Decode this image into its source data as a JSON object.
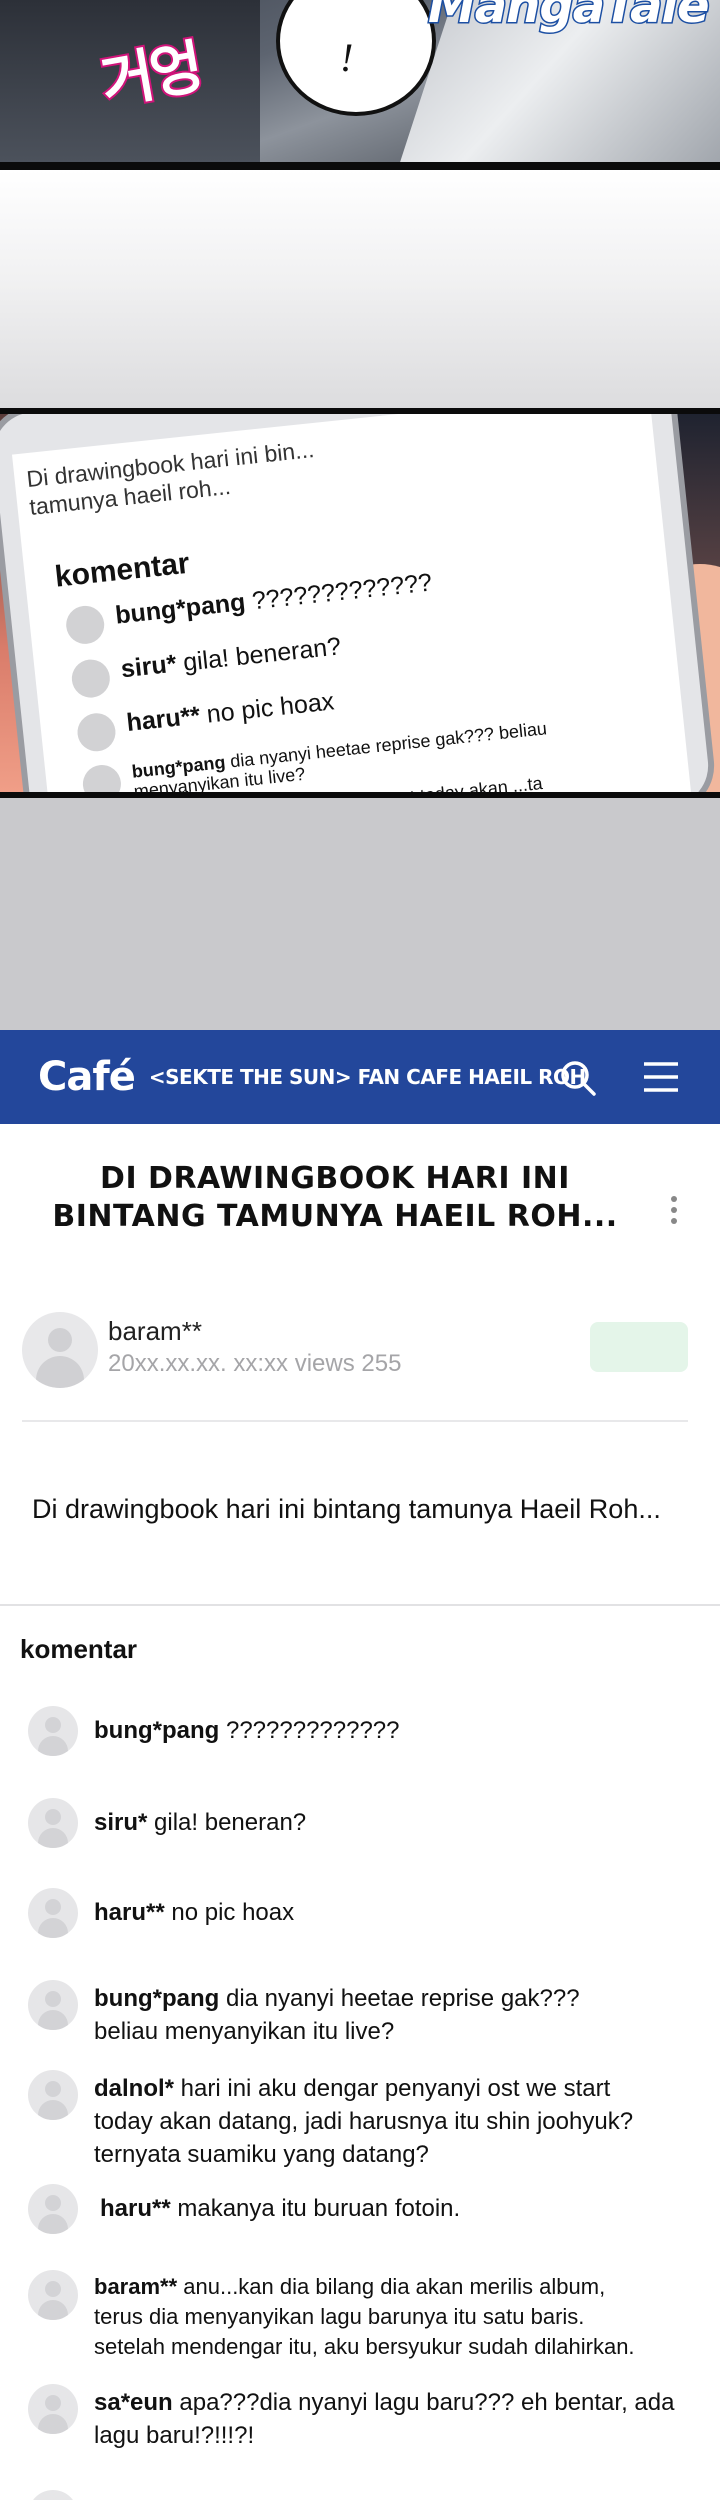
{
  "panel_top": {
    "sfx": "거엉",
    "bubble_text": "!",
    "watermark": "MangaTale"
  },
  "phone_screen": {
    "post_preview": "Di drawingbook hari ini bin... tamunya haeil roh...",
    "komentar_label": "komentar",
    "comments": [
      {
        "user": "bung*pang",
        "text": " ?????????????"
      },
      {
        "user": "siru*",
        "text": " gila! beneran?"
      },
      {
        "user": "haru**",
        "text": " no pic hoax"
      },
      {
        "user": "bung*pang",
        "text": " dia nyanyi heetae reprise gak??? beliau menyanyikan itu live?"
      },
      {
        "user": "",
        "text": "...aku dengar penyanyi ost we start today akan ...ta suamiku yang datang?"
      }
    ]
  },
  "cafe": {
    "logo": "Café",
    "title": "<SEKTE THE SUN> FAN CAFE HAEIL ROH",
    "post_title_line1": "DI DRAWINGBOOK HARI INI",
    "post_title_line2": "BINTANG TAMUNYA HAEIL ROH...",
    "author_name": "baram**",
    "author_meta": "20xx.xx.xx. xx:xx views 255",
    "post_body": "Di drawingbook hari ini bintang tamunya Haeil Roh...",
    "comments_heading": "komentar",
    "comments": [
      {
        "user": "bung*pang",
        "text": " ?????????????"
      },
      {
        "user": "siru*",
        "text": " gila! beneran?"
      },
      {
        "user": "haru**",
        "text": " no pic hoax"
      },
      {
        "user": "bung*pang",
        "text": " dia nyanyi heetae reprise gak???",
        "text2": "beliau menyanyikan itu live?"
      },
      {
        "user": "dalnol*",
        "text": " hari ini aku dengar penyanyi ost we start",
        "text2": "today akan datang, jadi harusnya itu shin joohyuk?",
        "text3": "ternyata suamiku yang datang?"
      },
      {
        "user": "haru**",
        "text": " makanya itu buruan fotoin."
      },
      {
        "user": "baram**",
        "text": " anu...kan dia bilang dia akan merilis album,",
        "text2": "terus dia menyanyikan lagu barunya itu satu baris.",
        "text3": "setelah mendengar itu, aku bersyukur sudah dilahirkan."
      },
      {
        "user": "sa*eun",
        "text": " apa???dia nyanyi lagu baru??? eh bentar, ada",
        "text2": "lagu baru!?!!!?!"
      }
    ],
    "accent_color": "#23479b"
  }
}
